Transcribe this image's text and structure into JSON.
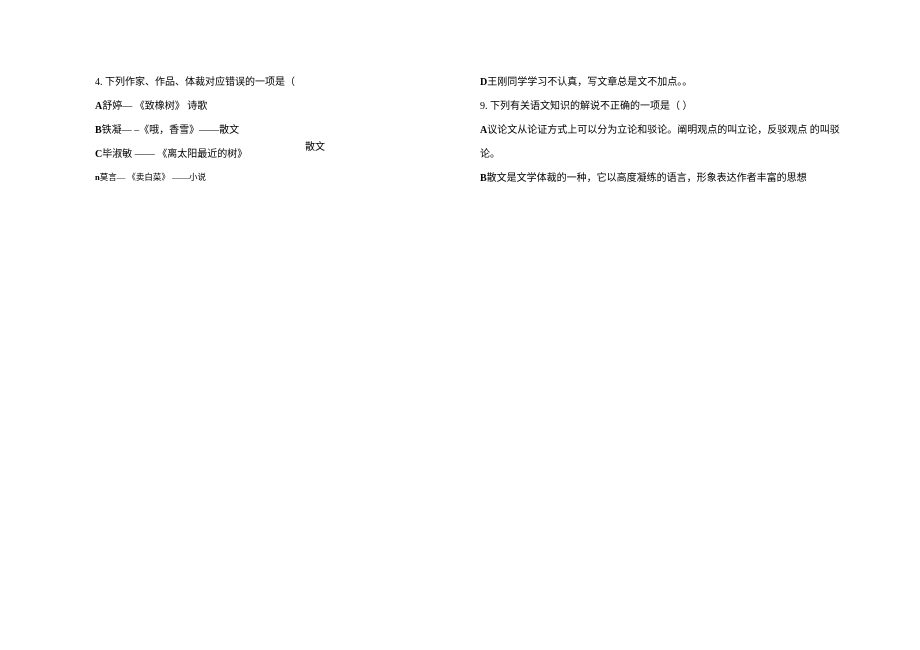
{
  "left": {
    "q4": {
      "num": "4.",
      "stem_gap": "        ",
      "stem": "下列作家、作品、体裁对应错误的一项是（"
    },
    "optA": {
      "label": "A",
      "author": "舒婷—",
      "gap": "        ",
      "work": "《致橡树》",
      "genre": "  诗歌"
    },
    "optB": {
      "label": "B",
      "author": "铁凝—",
      "gap": "   ",
      "dash": "–",
      "work": "《哦，香雪》——散文"
    },
    "optC": {
      "label": "C",
      "author": "毕淑敏",
      "gap": "     ",
      "dash": "——  ",
      "work": "《离太阳最近的树》",
      "float": "散文"
    },
    "optD": {
      "label": "n",
      "author": "莫言—",
      "gap": "            ",
      "work": "《卖白菜》  ——小说"
    }
  },
  "right": {
    "lineD": {
      "label": "D",
      "text": "王刚同学学习不认真，写文章总是文不加点。。"
    },
    "q9": {
      "num": "9.",
      "gap": "   ",
      "stem": "下列有关语文知识的解说不正确的一项是（",
      "space": "                       ",
      "close": "）"
    },
    "optA": {
      "label": "A",
      "text1": "议论文从论证方式上可以分为立论和驳论。阐明观点的叫立论，反驳观点  的叫驳",
      "text2": "论。"
    },
    "optB": {
      "label": "B",
      "text": "散文是文学体裁的一种，它以高度凝练的语言，形象表达作者丰富的思想"
    }
  }
}
